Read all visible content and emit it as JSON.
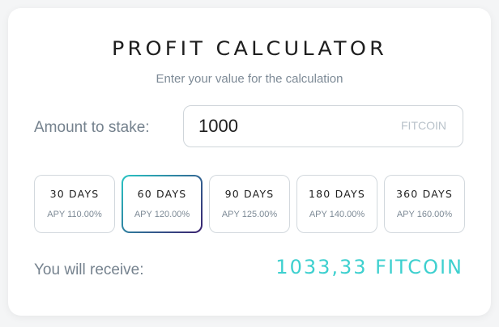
{
  "colors": {
    "accent": "#3ed0cf",
    "selected_border_start": "#28c6c4",
    "selected_border_end": "#3a1f6e"
  },
  "header": {
    "title": "PROFIT CALCULATOR",
    "subtitle": "Enter your value for the calculation"
  },
  "stake": {
    "label": "Amount to stake:",
    "value": "1000",
    "unit": "FITCOIN"
  },
  "periods": [
    {
      "days": "30 DAYS",
      "apy": "APY 110.00%",
      "selected": false
    },
    {
      "days": "60 DAYS",
      "apy": "APY 120.00%",
      "selected": true
    },
    {
      "days": "90 DAYS",
      "apy": "APY 125.00%",
      "selected": false
    },
    {
      "days": "180 DAYS",
      "apy": "APY 140.00%",
      "selected": false
    },
    {
      "days": "360 DAYS",
      "apy": "APY 160.00%",
      "selected": false
    }
  ],
  "result": {
    "label": "You will receive:",
    "value": "1033,33 FITCOIN"
  }
}
